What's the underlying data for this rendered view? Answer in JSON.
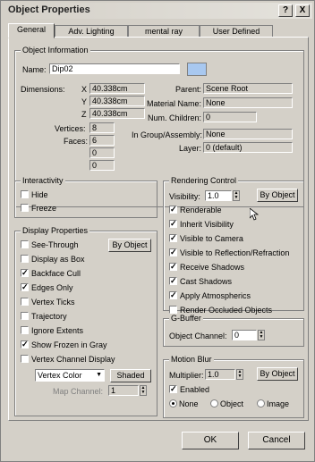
{
  "window": {
    "title": "Object Properties",
    "help_label": "?",
    "close_label": "X"
  },
  "tabs": [
    "General",
    "Adv. Lighting",
    "mental ray",
    "User Defined"
  ],
  "object_info": {
    "group_label": "Object Information",
    "name_label": "Name:",
    "name_value": "Dip02",
    "dimensions_label": "Dimensions:",
    "x_label": "X",
    "x_value": "40.338cm",
    "y_label": "Y",
    "y_value": "40.338cm",
    "z_label": "Z",
    "z_value": "40.338cm",
    "vertices_label": "Vertices:",
    "vertices_value": "8",
    "faces_label": "Faces:",
    "faces_value": "6",
    "extra_value_1": "0",
    "extra_value_2": "0",
    "parent_label": "Parent:",
    "parent_value": "Scene Root",
    "material_label": "Material Name:",
    "material_value": "None",
    "children_label": "Num. Children:",
    "children_value": "0",
    "group_assembly_label": "In Group/Assembly:",
    "group_assembly_value": "None",
    "layer_label": "Layer:",
    "layer_value": "0 (default)",
    "swatch_color": "#a8c8f0"
  },
  "interactivity": {
    "group_label": "Interactivity",
    "hide_label": "Hide",
    "freeze_label": "Freeze"
  },
  "display_properties": {
    "group_label": "Display Properties",
    "see_through": "See-Through",
    "display_as_box": "Display as Box",
    "backface_cull": "Backface Cull",
    "edges_only": "Edges Only",
    "vertex_ticks": "Vertex Ticks",
    "trajectory": "Trajectory",
    "ignore_extents": "Ignore Extents",
    "show_frozen_gray": "Show Frozen in Gray",
    "vertex_channel_display": "Vertex Channel Display",
    "by_object_label": "By Object",
    "vertex_color_value": "Vertex Color",
    "shaded_label": "Shaded",
    "map_channel_label": "Map Channel:",
    "map_channel_value": "1",
    "checked": {
      "see_through": false,
      "display_as_box": false,
      "backface_cull": true,
      "edges_only": true,
      "vertex_ticks": false,
      "trajectory": false,
      "ignore_extents": false,
      "show_frozen_gray": true,
      "vertex_channel_display": false
    }
  },
  "rendering_control": {
    "group_label": "Rendering Control",
    "visibility_label": "Visibility:",
    "visibility_value": "1.0",
    "by_object_label": "By Object",
    "renderable": "Renderable",
    "inherit_visibility": "Inherit Visibility",
    "visible_to_camera": "Visible to Camera",
    "visible_to_reflection": "Visible to Reflection/Refraction",
    "receive_shadows": "Receive Shadows",
    "cast_shadows": "Cast Shadows",
    "apply_atmospherics": "Apply Atmospherics",
    "render_occluded": "Render Occluded Objects",
    "checked": {
      "renderable": true,
      "inherit_visibility": true,
      "visible_to_camera": true,
      "visible_to_reflection": true,
      "receive_shadows": true,
      "cast_shadows": true,
      "apply_atmospherics": true,
      "render_occluded": false
    }
  },
  "gbuffer": {
    "group_label": "G-Buffer",
    "object_channel_label": "Object Channel:",
    "object_channel_value": "0"
  },
  "motion_blur": {
    "group_label": "Motion Blur",
    "multiplier_label": "Multiplier:",
    "multiplier_value": "1.0",
    "by_object_label": "By Object",
    "enabled_label": "Enabled",
    "enabled_checked": true,
    "none_label": "None",
    "object_label": "Object",
    "image_label": "Image",
    "selected": "none"
  },
  "footer": {
    "ok_label": "OK",
    "cancel_label": "Cancel"
  }
}
